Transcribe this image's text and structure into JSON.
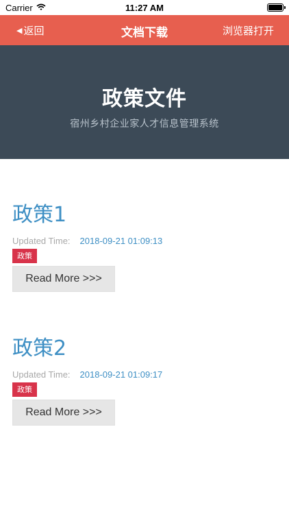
{
  "status_bar": {
    "carrier": "Carrier",
    "time": "11:27 AM",
    "battery_level": 1.0
  },
  "nav_bar": {
    "back_label": "返回",
    "title": "文档下载",
    "right_label": "浏览器打开"
  },
  "hero": {
    "title": "政策文件",
    "subtitle": "宿州乡村企业家人才信息管理系统"
  },
  "posts": [
    {
      "title": "政策1",
      "updated_label": "Updated Time:",
      "updated_value": "2018-09-21 01:09:13",
      "tag": "政策",
      "read_more": "Read More >>>"
    },
    {
      "title": "政策2",
      "updated_label": "Updated Time:",
      "updated_value": "2018-09-21 01:09:17",
      "tag": "政策",
      "read_more": "Read More >>>"
    }
  ]
}
